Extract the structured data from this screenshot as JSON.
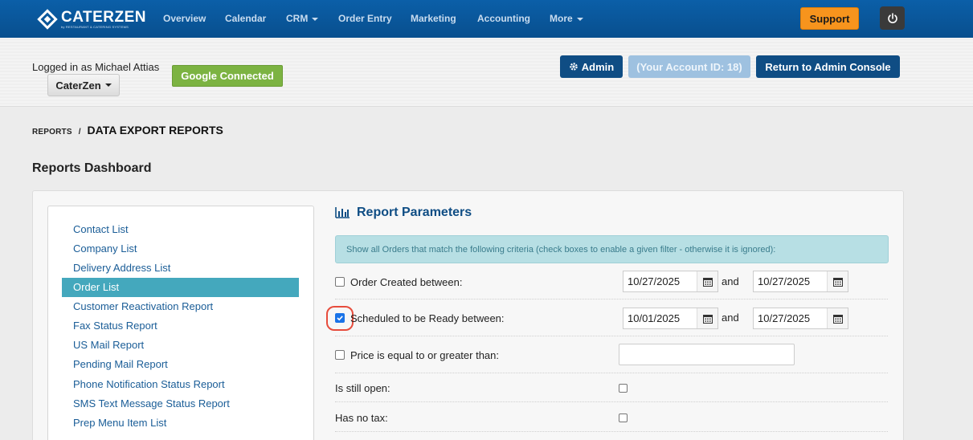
{
  "app": {
    "name": "CATERZEN",
    "tagline": "by RESTAURANT & CATERING SYSTEMS"
  },
  "nav": {
    "items": [
      {
        "label": "Overview"
      },
      {
        "label": "Calendar"
      },
      {
        "label": "CRM",
        "dropdown": true
      },
      {
        "label": "Order Entry"
      },
      {
        "label": "Marketing"
      },
      {
        "label": "Accounting"
      },
      {
        "label": "More",
        "dropdown": true
      }
    ],
    "support_label": "Support",
    "power_icon": "power-icon"
  },
  "account": {
    "logged_in_text": "Logged in as Michael Attias",
    "company_dropdown": "CaterZen",
    "google_label": "Google Connected",
    "admin_label": "Admin",
    "account_id_label": "(Your Account ID: 18)",
    "return_label": "Return to Admin Console"
  },
  "breadcrumb": {
    "parent": "REPORTS",
    "separator": "/",
    "current": "DATA EXPORT REPORTS"
  },
  "dashboard_title": "Reports Dashboard",
  "sidebar": {
    "items": [
      {
        "label": "Contact List",
        "active": false
      },
      {
        "label": "Company List",
        "active": false
      },
      {
        "label": "Delivery Address List",
        "active": false
      },
      {
        "label": "Order List",
        "active": true
      },
      {
        "label": "Customer Reactivation Report",
        "active": false
      },
      {
        "label": "Fax Status Report",
        "active": false
      },
      {
        "label": "US Mail Report",
        "active": false
      },
      {
        "label": "Pending Mail Report",
        "active": false
      },
      {
        "label": "Phone Notification Status Report",
        "active": false
      },
      {
        "label": "SMS Text Message Status Report",
        "active": false
      },
      {
        "label": "Prep Menu Item List",
        "active": false
      }
    ]
  },
  "params": {
    "title": "Report Parameters",
    "info": "Show all Orders that match the following criteria (check boxes to enable a given filter - otherwise it is ignored):",
    "rows": {
      "created": {
        "label": "Order Created between:",
        "checked": false,
        "from": "10/27/2025",
        "and": "and",
        "to": "10/27/2025"
      },
      "scheduled": {
        "label": "Scheduled to be Ready between:",
        "checked": true,
        "from": "10/01/2025",
        "and": "and",
        "to": "10/27/2025"
      },
      "price": {
        "label": "Price is equal to or greater than:",
        "checked": false,
        "value": ""
      },
      "open": {
        "label": "Is still open:",
        "checked": false
      },
      "notax": {
        "label": "Has no tax:",
        "checked": false
      }
    }
  },
  "colors": {
    "nav_bg": "#0b5fa8",
    "accent_teal": "#44a8bd",
    "support_orange": "#f7941d",
    "google_green": "#7cb342",
    "admin_navy": "#0f4d84",
    "highlight_red": "#e74c3c"
  }
}
